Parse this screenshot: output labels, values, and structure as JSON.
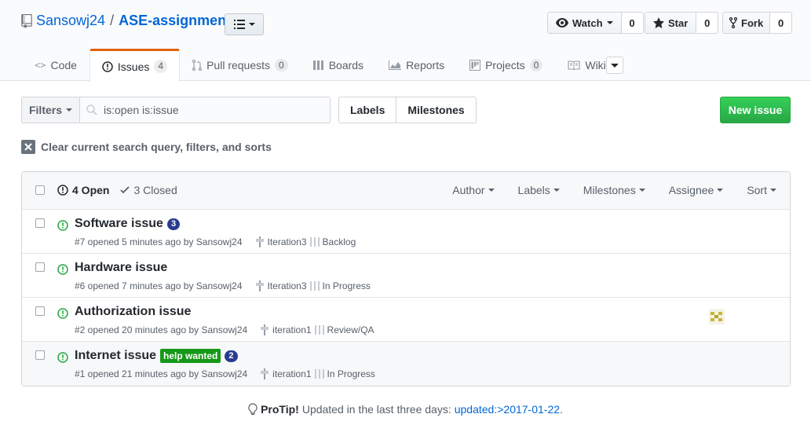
{
  "repo": {
    "owner": "Sansowj24",
    "separator": "/",
    "name": "ASE-assignment"
  },
  "actions": [
    {
      "label": "Watch",
      "count": "0"
    },
    {
      "label": "Star",
      "count": "0"
    },
    {
      "label": "Fork",
      "count": "0"
    }
  ],
  "nav": {
    "code": "Code",
    "issues": "Issues",
    "issues_count": "4",
    "pulls": "Pull requests",
    "pulls_count": "0",
    "boards": "Boards",
    "reports": "Reports",
    "projects": "Projects",
    "projects_count": "0",
    "wiki": "Wiki"
  },
  "subnav": {
    "filters": "Filters",
    "search_value": "is:open is:issue",
    "labels": "Labels",
    "milestones": "Milestones",
    "new_issue": "New issue"
  },
  "clear_query": "Clear current search query, filters, and sorts",
  "header": {
    "open": "4 Open",
    "closed": "3 Closed",
    "author": "Author",
    "labels": "Labels",
    "milestones": "Milestones",
    "assignee": "Assignee",
    "sort": "Sort"
  },
  "issues": [
    {
      "title": "Software issue",
      "count": "3",
      "label": "",
      "meta": "#7 opened 5 minutes ago by Sansowj24",
      "milestone": "Iteration3",
      "pipeline": "Backlog",
      "has_avatar": false
    },
    {
      "title": "Hardware issue",
      "count": "",
      "label": "",
      "meta": "#6 opened 7 minutes ago by Sansowj24",
      "milestone": "Iteration3",
      "pipeline": "In Progress",
      "has_avatar": false
    },
    {
      "title": "Authorization issue",
      "count": "",
      "label": "",
      "meta": "#2 opened 20 minutes ago by Sansowj24",
      "milestone": "iteration1",
      "pipeline": "Review/QA",
      "has_avatar": true
    },
    {
      "title": "Internet issue",
      "count": "2",
      "label": "help wanted",
      "meta": "#1 opened 21 minutes ago by Sansowj24",
      "milestone": "iteration1",
      "pipeline": "In Progress",
      "has_avatar": false
    }
  ],
  "protip": {
    "prefix": "ProTip!",
    "text": "Updated in the last three days:",
    "link": "updated:>2017-01-22",
    "suffix": "."
  },
  "colors": {
    "accent": "#0366d6",
    "open_issue": "#28a745",
    "nav_selected": "#e36209",
    "label_help_wanted": "#159818",
    "count_badge": "#2a3b8f"
  }
}
